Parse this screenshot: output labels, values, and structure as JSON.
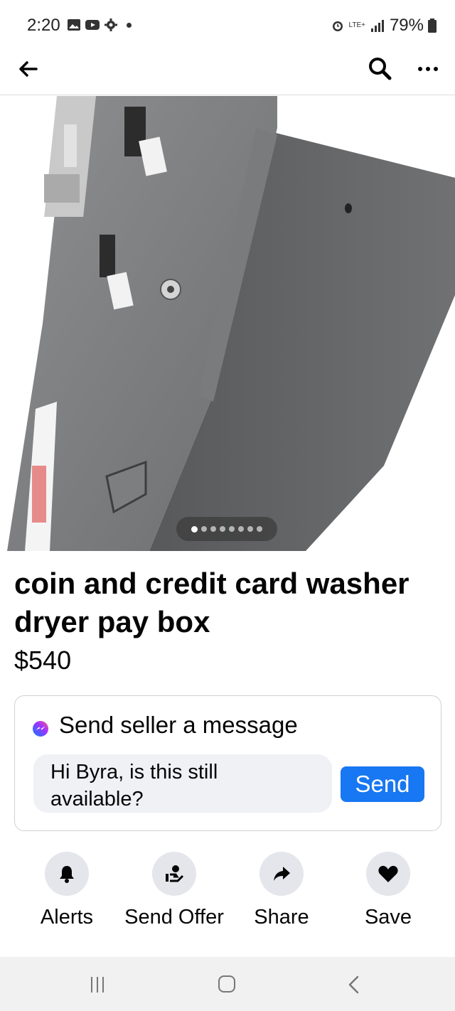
{
  "status_bar": {
    "time": "2:20",
    "lte_label": "LTE+",
    "battery_text": "79%",
    "icons": [
      "gallery-icon",
      "youtube-icon",
      "settings-icon",
      "alarm-icon",
      "signal-icon",
      "battery-icon"
    ]
  },
  "top_nav": {
    "icons": [
      "back-arrow-icon",
      "search-icon",
      "more-icon"
    ]
  },
  "photo": {
    "carousel_count": 8,
    "carousel_active": 1
  },
  "listing": {
    "title": "coin and credit card washer dryer pay box",
    "price": "$540"
  },
  "message_card": {
    "header": "Send seller a message",
    "message_text": "Hi Byra, is this still available?",
    "send_label": "Send",
    "icon": "messenger-icon"
  },
  "actions": [
    {
      "label": "Alerts",
      "icon": "bell-icon"
    },
    {
      "label": "Send Offer",
      "icon": "offer-hand-icon"
    },
    {
      "label": "Share",
      "icon": "share-arrow-icon"
    },
    {
      "label": "Save",
      "icon": "heart-icon"
    }
  ],
  "colors": {
    "accent": "#1877f2",
    "action_circle": "#e4e6eb",
    "input_bg": "#eff1f4",
    "nav_bar_bg": "#f1f1f1"
  }
}
